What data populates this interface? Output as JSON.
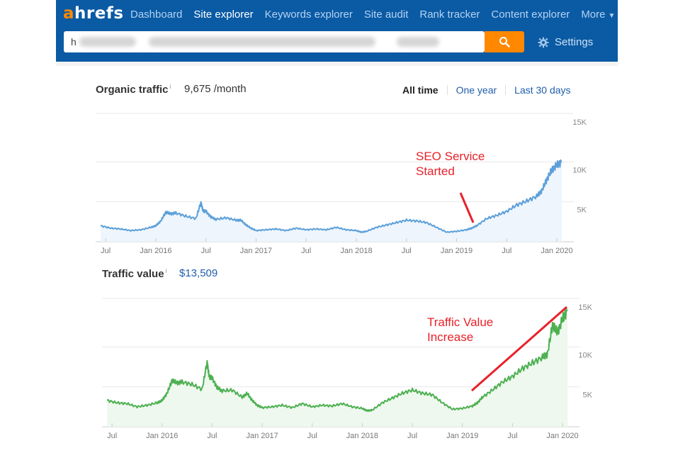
{
  "app": {
    "logo_a": "a",
    "logo_rest": "hrefs",
    "nav": [
      {
        "label": "Dashboard",
        "active": false
      },
      {
        "label": "Site explorer",
        "active": true
      },
      {
        "label": "Keywords explorer",
        "active": false
      },
      {
        "label": "Site audit",
        "active": false
      },
      {
        "label": "Rank tracker",
        "active": false
      },
      {
        "label": "Content explorer",
        "active": false
      },
      {
        "label": "More",
        "active": false
      }
    ],
    "search_value_visible": "h",
    "search_value_blurred": true,
    "settings_label": "Settings",
    "colors": {
      "header": "#0a5aa4",
      "search_button": "#ff8800",
      "link": "#1f5ea8",
      "annotation": "#e8212a"
    }
  },
  "organic": {
    "title": "Organic traffic",
    "info": "i",
    "value": "9,675 /month"
  },
  "range": {
    "options": [
      "All time",
      "One year",
      "Last 30 days"
    ],
    "selected": "All time"
  },
  "traffic_value": {
    "title": "Traffic value",
    "info": "i",
    "value": "$13,509"
  },
  "chart_data": [
    {
      "type": "area",
      "title": "Organic traffic",
      "color": "#5b9fd9",
      "fill": "#eef5fc",
      "x_ticks": [
        "Jul",
        "Jan 2016",
        "Jul",
        "Jan 2017",
        "Jul",
        "Jan 2018",
        "Jul",
        "Jan 2019",
        "Jul",
        "Jan 2020"
      ],
      "x_range": [
        "2015-06",
        "2020-02"
      ],
      "y_ticks": [
        "5K",
        "10K",
        "15K"
      ],
      "ylim": [
        0,
        15000
      ],
      "grid": true,
      "x": [
        2015.45,
        2015.55,
        2015.65,
        2015.75,
        2015.85,
        2015.95,
        2016.0,
        2016.05,
        2016.1,
        2016.15,
        2016.2,
        2016.3,
        2016.4,
        2016.45,
        2016.47,
        2016.5,
        2016.55,
        2016.6,
        2016.7,
        2016.8,
        2016.85,
        2016.9,
        2016.95,
        2017.0,
        2017.1,
        2017.2,
        2017.3,
        2017.4,
        2017.5,
        2017.6,
        2017.7,
        2017.8,
        2017.9,
        2018.0,
        2018.05,
        2018.1,
        2018.2,
        2018.3,
        2018.4,
        2018.5,
        2018.6,
        2018.7,
        2018.8,
        2018.9,
        2019.0,
        2019.1,
        2019.15,
        2019.2,
        2019.3,
        2019.4,
        2019.5,
        2019.6,
        2019.7,
        2019.8,
        2019.85,
        2019.9,
        2019.95,
        2020.0,
        2020.05
      ],
      "values": [
        2000,
        1700,
        1600,
        1400,
        1500,
        1800,
        2000,
        2600,
        3700,
        3500,
        3600,
        3200,
        2900,
        4900,
        3900,
        3800,
        3100,
        2800,
        3000,
        2700,
        2700,
        2100,
        1700,
        1400,
        1500,
        1600,
        1400,
        1700,
        1500,
        1600,
        1500,
        1800,
        1500,
        1400,
        1200,
        1300,
        1800,
        2100,
        2400,
        2700,
        2600,
        2400,
        1800,
        1200,
        1300,
        1500,
        1700,
        2000,
        2900,
        3300,
        3800,
        4600,
        5100,
        5700,
        6400,
        7800,
        9000,
        9600,
        10000
      ]
    },
    {
      "type": "area",
      "title": "Traffic value",
      "color": "#4cb050",
      "fill": "#eef8ee",
      "x_ticks": [
        "Jul",
        "Jan 2016",
        "Jul",
        "Jan 2017",
        "Jul",
        "Jan 2018",
        "Jul",
        "Jan 2019",
        "Jul",
        "Jan 2020"
      ],
      "x_range": [
        "2015-06",
        "2020-02"
      ],
      "y_ticks": [
        "5K",
        "10K",
        "15K"
      ],
      "ylim": [
        0,
        15000
      ],
      "grid": true,
      "x": [
        2015.45,
        2015.55,
        2015.65,
        2015.75,
        2015.85,
        2015.95,
        2016.0,
        2016.05,
        2016.1,
        2016.15,
        2016.2,
        2016.3,
        2016.4,
        2016.45,
        2016.47,
        2016.5,
        2016.55,
        2016.6,
        2016.7,
        2016.8,
        2016.85,
        2016.9,
        2016.95,
        2017.0,
        2017.1,
        2017.2,
        2017.3,
        2017.4,
        2017.5,
        2017.6,
        2017.7,
        2017.8,
        2017.9,
        2018.0,
        2018.05,
        2018.1,
        2018.2,
        2018.3,
        2018.4,
        2018.5,
        2018.6,
        2018.7,
        2018.8,
        2018.9,
        2019.0,
        2019.1,
        2019.15,
        2019.2,
        2019.3,
        2019.4,
        2019.5,
        2019.6,
        2019.7,
        2019.8,
        2019.85,
        2019.9,
        2019.95,
        2020.0,
        2020.05
      ],
      "values": [
        3300,
        3000,
        2900,
        2500,
        2700,
        3000,
        3300,
        4200,
        5800,
        5500,
        5600,
        5300,
        4700,
        8100,
        6300,
        6100,
        4900,
        4500,
        4600,
        3700,
        4200,
        3300,
        2700,
        2400,
        2500,
        2700,
        2400,
        2900,
        2500,
        2700,
        2600,
        2900,
        2500,
        2300,
        2000,
        2100,
        3000,
        3600,
        4200,
        4600,
        4200,
        4000,
        3000,
        2200,
        2300,
        2600,
        3000,
        3700,
        4600,
        5600,
        6300,
        7300,
        8000,
        8700,
        9100,
        12800,
        11800,
        13500,
        14600
      ]
    }
  ],
  "annotations": {
    "seo": [
      "SEO Service",
      "Started"
    ],
    "value": [
      "Traffic Value",
      "Increase"
    ]
  }
}
